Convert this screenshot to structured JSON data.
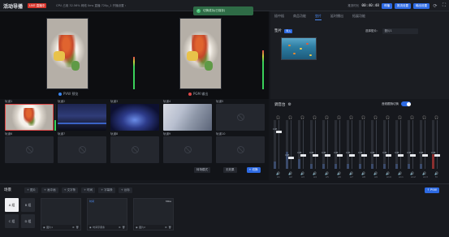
{
  "app": {
    "title": "活动导播",
    "live_badge": "LIVE 直播中",
    "stats": "CPU 占用 32.56%  网络 0ms  直播 720p_1  开播设置 ›",
    "timer_label": "推流时长",
    "timer": "00:40:48",
    "btn_stop": "停播",
    "btn_push": "推流设置",
    "btn_output": "输出设置"
  },
  "toast": {
    "text": "切换成功(已保存)"
  },
  "preview": {
    "pvw_label": "PVW 预览",
    "pgm_label": "PGM 输出"
  },
  "sources": [
    {
      "label": "轨道1",
      "kind": "food",
      "active": true
    },
    {
      "label": "轨道2",
      "kind": "night",
      "active": false
    },
    {
      "label": "轨道3",
      "kind": "blue",
      "active": false
    },
    {
      "label": "轨道4",
      "kind": "cherry",
      "active": false
    },
    {
      "label": "轨道5",
      "kind": "empty",
      "active": false
    },
    {
      "label": "轨道6",
      "kind": "empty",
      "active": false
    },
    {
      "label": "轨道7",
      "kind": "empty",
      "active": false
    },
    {
      "label": "轨道8",
      "kind": "empty",
      "active": false
    },
    {
      "label": "轨道9",
      "kind": "empty",
      "active": false
    },
    {
      "label": "轨道10",
      "kind": "empty",
      "active": false
    }
  ],
  "source_controls": {
    "transition": "转场模式",
    "duration": "无效果",
    "take": "+ 切换"
  },
  "right_panel": {
    "tabs": [
      "插中插",
      "商品功能",
      "垫片",
      "延时播出",
      "拓展功能"
    ],
    "active_tab": 2,
    "section": "垫片",
    "section_tag": "导入",
    "select_label": "选择垫片：",
    "select_value": "垫片1"
  },
  "mixer": {
    "title": "调音台",
    "toggle_label": "音频跟随切换",
    "channels": [
      {
        "db": "0dB",
        "level": 0.15,
        "fader": 0.78,
        "icon": "A1"
      },
      {
        "db": "0dB",
        "level": 0.35,
        "fader": 0.25,
        "icon": "A2"
      },
      {
        "db": "0dB",
        "level": 0.2,
        "fader": 0.3,
        "icon": "A3"
      },
      {
        "db": "0dB",
        "level": 0.1,
        "fader": 0.3,
        "icon": "A4"
      },
      {
        "db": "0dB",
        "level": 0.1,
        "fader": 0.3,
        "icon": "A5"
      },
      {
        "db": "0dB",
        "level": 0.1,
        "fader": 0.3,
        "icon": "A6"
      },
      {
        "db": "0dB",
        "level": 0.1,
        "fader": 0.3,
        "icon": "A7"
      },
      {
        "db": "0dB",
        "level": 0.1,
        "fader": 0.3,
        "icon": "A8"
      },
      {
        "db": "0dB",
        "level": 0.1,
        "fader": 0.3,
        "icon": "A9"
      },
      {
        "db": "0dB",
        "level": 0.1,
        "fader": 0.3,
        "icon": "A10"
      },
      {
        "db": "0dB",
        "level": 0.1,
        "fader": 0.3,
        "icon": "A11"
      },
      {
        "db": "0dB",
        "level": 0.1,
        "fader": 0.3,
        "icon": "A12"
      },
      {
        "db": "0dB",
        "level": 0.1,
        "fader": 0.3,
        "icon": "A13"
      },
      {
        "db": "0dB",
        "level": 0.3,
        "fader": 0.3,
        "icon": "M"
      }
    ]
  },
  "scenes": {
    "title": "场景",
    "buttons": [
      "A 组",
      "B 组",
      "C 组",
      "D 组"
    ],
    "active": 0,
    "add_buttons": [
      "+ 图片",
      "+ 画中画",
      "+ 文字条",
      "+ 时间",
      "+ 字幕条",
      "+ 台标"
    ],
    "pvw_button": "↑ PVW",
    "cards": [
      {
        "name": "图片1",
        "tag": "",
        "corner": ""
      },
      {
        "name": "时间字幕条",
        "tag": "时间",
        "corner": ""
      },
      {
        "name": "图片2",
        "tag": "",
        "corner": "Mike"
      }
    ]
  },
  "colors": {
    "accent": "#2d6ae3",
    "live": "#d9342b",
    "pvw_dot": "#3a86f0",
    "pgm_dot": "#e04848",
    "toast_bg": "#2e6b46"
  }
}
